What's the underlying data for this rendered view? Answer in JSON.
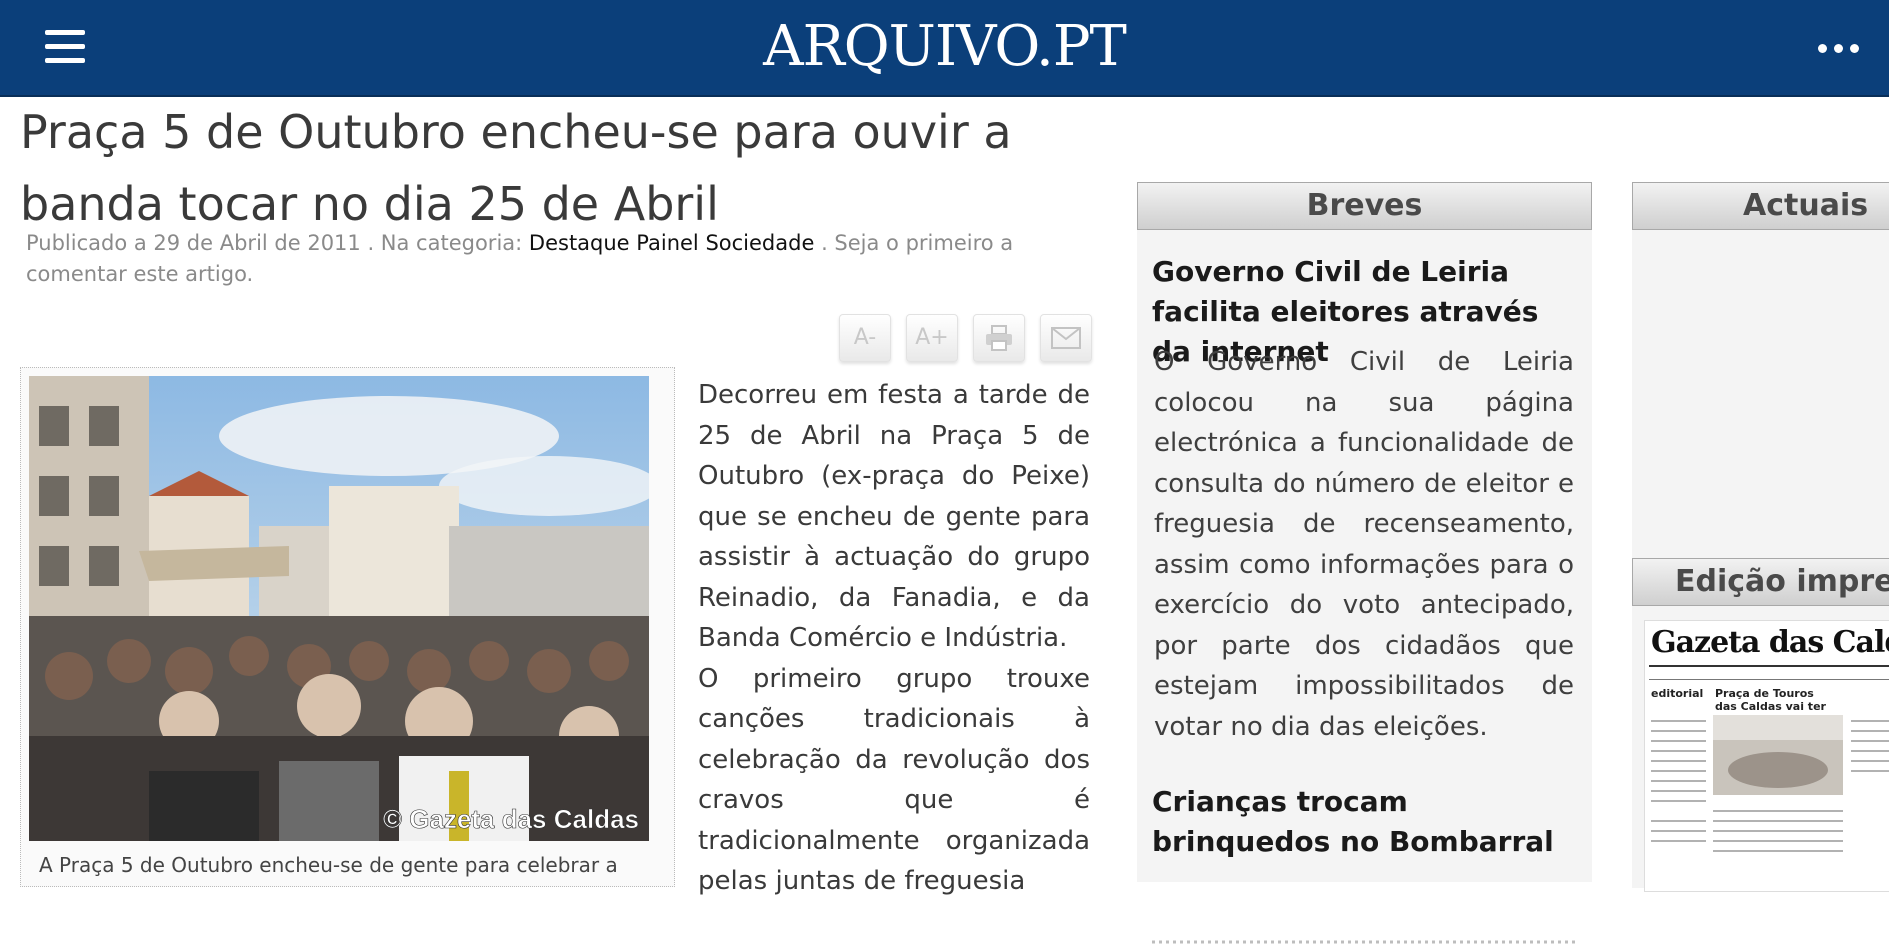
{
  "header": {
    "brand": "ARQUIVO.PT",
    "menu_icon": "hamburger-menu-icon",
    "more_icon": "more-dots-icon",
    "bg_color": "#0b3f7a"
  },
  "article": {
    "title": "Praça 5 de Outubro encheu-se para ouvir a banda tocar no dia 25 de Abril",
    "meta_prefix": "Publicado a 29 de Abril de 2011 . Na categoria:",
    "category": "Destaque Painel Sociedade",
    "meta_suffix": ". Seja o primeiro a comentar este artigo.",
    "tools": [
      {
        "label": "A-",
        "icon": "font-decrease-icon"
      },
      {
        "label": "A+",
        "icon": "font-increase-icon"
      },
      {
        "label": "",
        "icon": "print-icon"
      },
      {
        "label": "",
        "icon": "email-icon"
      }
    ],
    "photo_watermark": "© Gazeta das Caldas",
    "photo_caption": "A Praça 5 de Outubro encheu-se de gente para celebrar a",
    "paragraphs": [
      "Decorreu em festa a tarde de 25 de Abril na Praça 5 de Outubro (ex-praça do Peixe) que se encheu de gente para assistir à actuação do grupo Reinadio, da Fanadia, e da Banda Comércio e Indústria.",
      "O primeiro grupo trouxe canções tradicionais à celebração da revolução dos cravos que é tradicionalmente organizada pelas juntas de freguesia"
    ]
  },
  "breves": {
    "heading": "Breves",
    "items": [
      {
        "title": "Governo Civil de Leiria facilita eleitores através da internet",
        "text": "O Governo Civil de Leiria colocou na sua página electrónica a funcionalidade de consulta do número de eleitor e freguesia de recenseamento, assim como informações para o exercício do voto antecipado, por parte dos cidadãos que estejam impossibilitados de votar no dia das eleições."
      },
      {
        "title": "Crianças trocam brinquedos no Bombarral",
        "text": ""
      }
    ]
  },
  "actuais": {
    "heading": "Actuais"
  },
  "edicao": {
    "heading": "Edição impres",
    "paper_masthead": "Gazeta das Caldas",
    "paper_col1": "editorial",
    "paper_col2": "Praça de Touros das Caldas vai ter zona comercial"
  }
}
